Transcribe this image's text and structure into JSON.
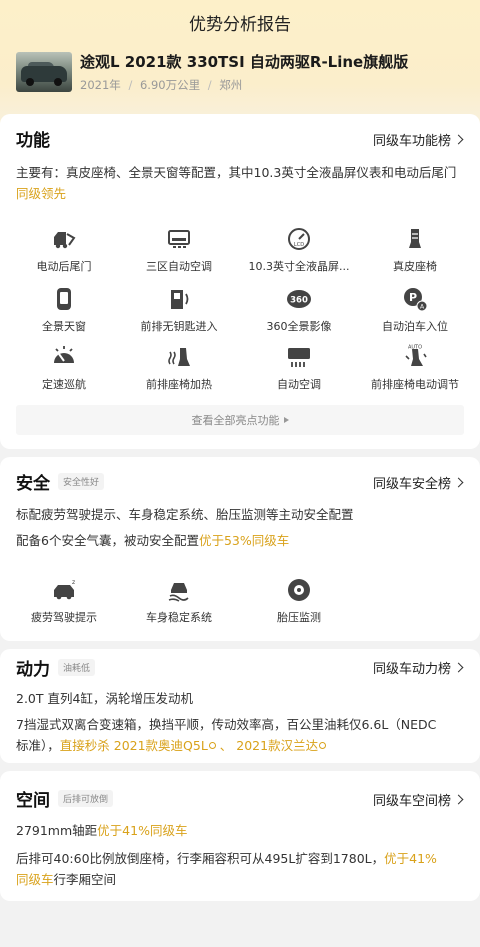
{
  "page": {
    "title": "优势分析报告"
  },
  "car": {
    "name": "途观L 2021款 330TSI 自动两驱R-Line旗舰版",
    "year": "2021年",
    "sep1": "/",
    "mileage": "6.90万公里",
    "sep2": "/",
    "city": "郑州"
  },
  "function": {
    "title": "功能",
    "rank_label": "同级车功能榜",
    "desc_prefix": "主要有：真皮座椅、全景天窗等配置，其中10.3英寸全液晶屏仪表和电动后尾门",
    "desc_highlight": "同级领先",
    "features": [
      {
        "label": "电动后尾门",
        "icon": "power-tailgate-icon"
      },
      {
        "label": "三区自动空调",
        "icon": "climate-control-icon"
      },
      {
        "label": "10.3英寸全液晶屏...",
        "icon": "lcd-gauge-icon"
      },
      {
        "label": "真皮座椅",
        "icon": "leather-seat-icon"
      },
      {
        "label": "全景天窗",
        "icon": "panoramic-sunroof-icon"
      },
      {
        "label": "前排无钥匙进入",
        "icon": "keyless-entry-icon"
      },
      {
        "label": "360全景影像",
        "icon": "camera-360-icon"
      },
      {
        "label": "自动泊车入位",
        "icon": "auto-parking-icon"
      },
      {
        "label": "定速巡航",
        "icon": "cruise-control-icon"
      },
      {
        "label": "前排座椅加热",
        "icon": "seat-heating-icon"
      },
      {
        "label": "自动空调",
        "icon": "auto-ac-icon"
      },
      {
        "label": "前排座椅电动调节",
        "icon": "power-seat-icon"
      }
    ],
    "see_all": "查看全部亮点功能"
  },
  "safety": {
    "title": "安全",
    "tag": "安全性好",
    "rank_label": "同级车安全榜",
    "line1": "标配疲劳驾驶提示、车身稳定系统、胎压监测等主动安全配置",
    "line2_prefix": "配备6个安全气囊，被动安全配置",
    "line2_highlight": "优于53%同级车",
    "features": [
      {
        "label": "疲劳驾驶提示",
        "icon": "fatigue-alert-icon"
      },
      {
        "label": "车身稳定系统",
        "icon": "stability-control-icon"
      },
      {
        "label": "胎压监测",
        "icon": "tire-pressure-icon"
      }
    ]
  },
  "power": {
    "title": "动力",
    "tag": "油耗低",
    "rank_label": "同级车动力榜",
    "line1": "2.0T 直列4缸，涡轮增压发动机",
    "line2": "7挡湿式双离合变速箱，换挡平顺，传动效率高，百公里油耗仅6.6L（NEDC",
    "line3_prefix": "标准），",
    "line3_highlight1": "直接秒杀 2021款奥迪Q5L",
    "line3_sep": " 、 ",
    "line3_highlight2": "2021款汉兰达"
  },
  "space": {
    "title": "空间",
    "tag": "后排可放倒",
    "rank_label": "同级车空间榜",
    "line1_prefix": "2791mm轴距",
    "line1_highlight": "优于41%同级车",
    "line2_prefix": "后排可40:60比例放倒座椅，行李厢容积可从495L扩容到1780L，",
    "line2_highlight": "优于41%",
    "line3_highlight": "同级车",
    "line3_suffix": "行李厢空间"
  }
}
